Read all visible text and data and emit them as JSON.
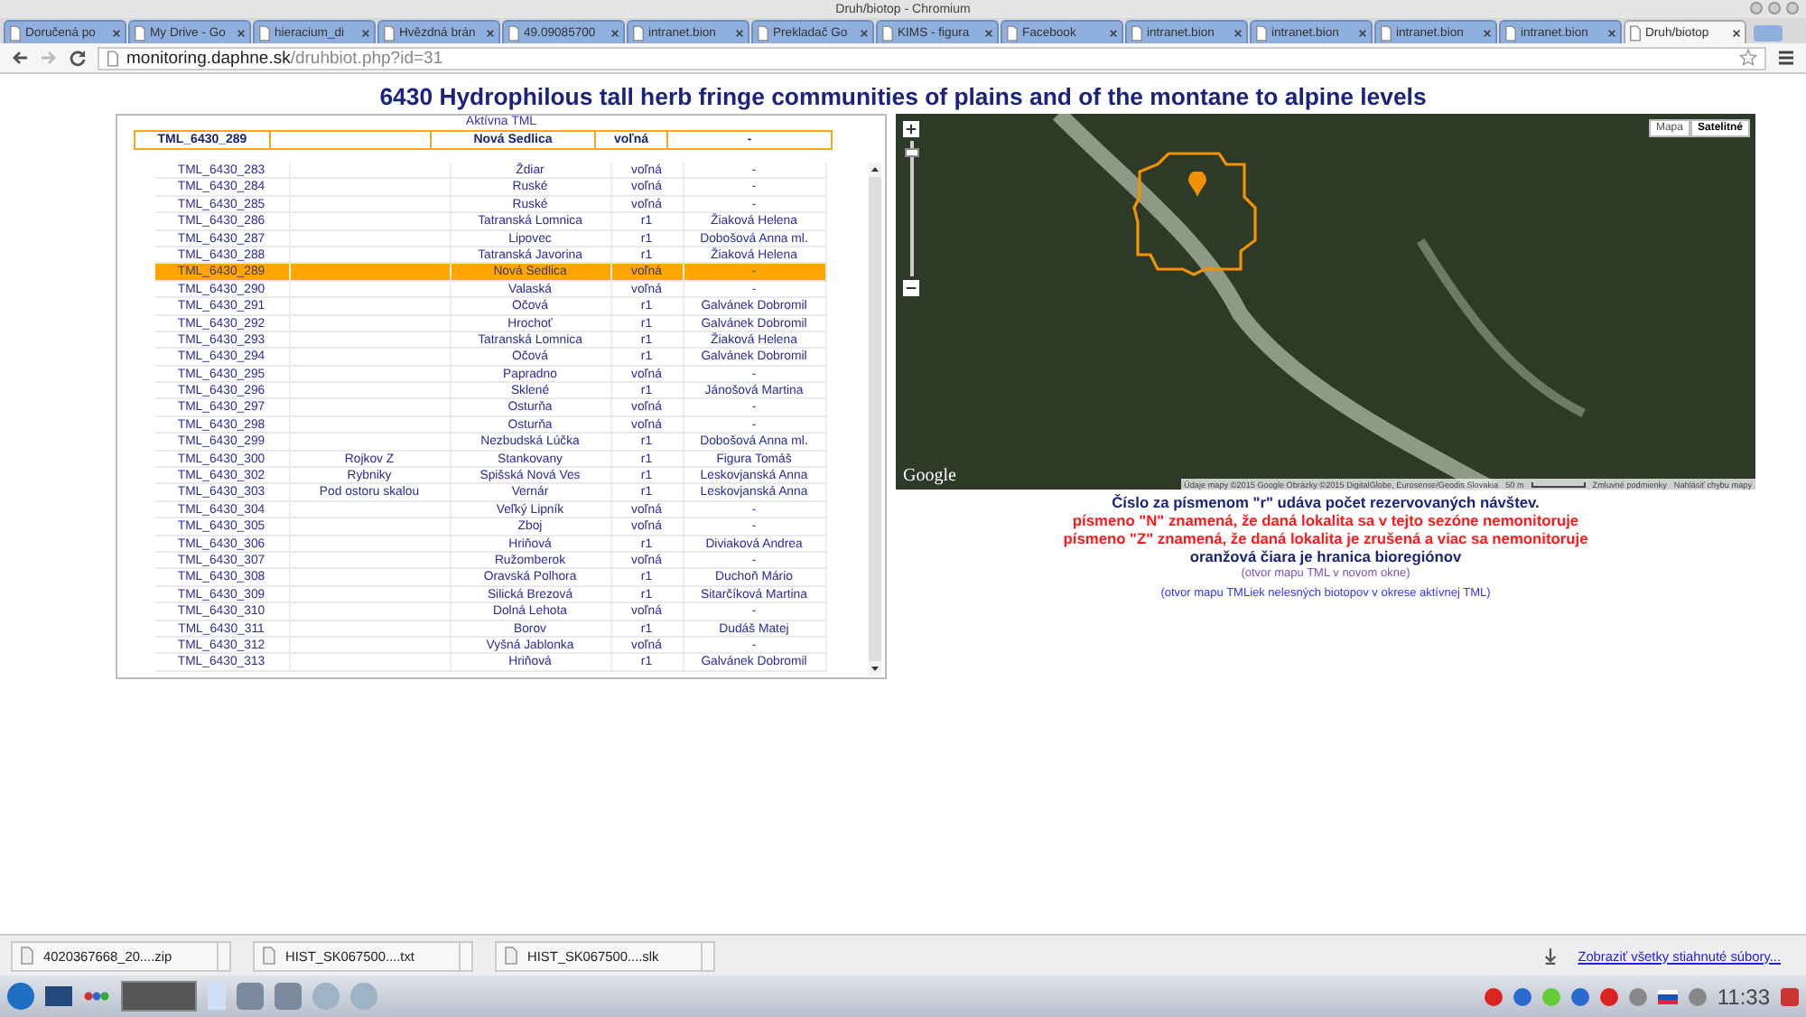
{
  "window": {
    "title": "Druh/biotop - Chromium"
  },
  "tabs": [
    {
      "label": "Doručená po",
      "selected": false
    },
    {
      "label": "My Drive - Go",
      "selected": false
    },
    {
      "label": "hieracium_di",
      "selected": false
    },
    {
      "label": "Hvězdná brán",
      "selected": false
    },
    {
      "label": "49.09085700",
      "selected": false
    },
    {
      "label": "intranet.bion",
      "selected": false
    },
    {
      "label": "Prekladač Go",
      "selected": false
    },
    {
      "label": "KIMS - figura",
      "selected": false
    },
    {
      "label": "Facebook",
      "selected": false
    },
    {
      "label": "intranet.bion",
      "selected": false
    },
    {
      "label": "intranet.bion",
      "selected": false
    },
    {
      "label": "intranet.bion",
      "selected": false
    },
    {
      "label": "intranet.bion",
      "selected": false
    },
    {
      "label": "Druh/biotop",
      "selected": true
    }
  ],
  "address": {
    "host": "monitoring.daphne.sk",
    "path": "/druhbiot.php?id=31"
  },
  "page": {
    "heading": "6430 Hydrophilous tall herb fringe communities of plains and of the montane to alpine levels",
    "active_caption": "Aktívna TML",
    "active_row": {
      "column_1": "TML_6430_289",
      "column_3": "Nová Sedlica",
      "column_4": "voľná",
      "column_5": "-"
    },
    "rows": [
      {
        "column_1": "TML_6430_283",
        "column_3": "Ždiar",
        "column_4": "voľná",
        "column_5": "-",
        "selected": false
      },
      {
        "column_1": "TML_6430_284",
        "column_3": "Ruské",
        "column_4": "voľná",
        "column_5": "-",
        "selected": false
      },
      {
        "column_1": "TML_6430_285",
        "column_3": "Ruské",
        "column_4": "voľná",
        "column_5": "-",
        "selected": false
      },
      {
        "column_1": "TML_6430_286",
        "column_3": "Tatranská Lomnica",
        "column_4": "r1",
        "column_5": "Žiaková Helena",
        "selected": false
      },
      {
        "column_1": "TML_6430_287",
        "column_3": "Lipovec",
        "column_4": "r1",
        "column_5": "Dobošová Anna ml.",
        "selected": false
      },
      {
        "column_1": "TML_6430_288",
        "column_3": "Tatranská Javorina",
        "column_4": "r1",
        "column_5": "Žiaková Helena",
        "selected": false
      },
      {
        "column_1": "TML_6430_289",
        "column_3": "Nová Sedlica",
        "column_4": "voľná",
        "column_5": "-",
        "selected": true
      },
      {
        "column_1": "TML_6430_290",
        "column_3": "Valaská",
        "column_4": "voľná",
        "column_5": "-",
        "selected": false
      },
      {
        "column_1": "TML_6430_291",
        "column_3": "Očová",
        "column_4": "r1",
        "column_5": "Galvánek Dobromil",
        "selected": false
      },
      {
        "column_1": "TML_6430_292",
        "column_3": "Hrochoť",
        "column_4": "r1",
        "column_5": "Galvánek Dobromil",
        "selected": false
      },
      {
        "column_1": "TML_6430_293",
        "column_3": "Tatranská Lomnica",
        "column_4": "r1",
        "column_5": "Žiaková Helena",
        "selected": false
      },
      {
        "column_1": "TML_6430_294",
        "column_3": "Očová",
        "column_4": "r1",
        "column_5": "Galvánek Dobromil",
        "selected": false
      },
      {
        "column_1": "TML_6430_295",
        "column_3": "Papradno",
        "column_4": "voľná",
        "column_5": "-",
        "selected": false
      },
      {
        "column_1": "TML_6430_296",
        "column_3": "Sklené",
        "column_4": "r1",
        "column_5": "Jánošová Martina",
        "selected": false
      },
      {
        "column_1": "TML_6430_297",
        "column_3": "Osturňa",
        "column_4": "voľná",
        "column_5": "-",
        "selected": false
      },
      {
        "column_1": "TML_6430_298",
        "column_3": "Osturňa",
        "column_4": "voľná",
        "column_5": "-",
        "selected": false
      },
      {
        "column_1": "TML_6430_299",
        "column_3": "Nezbudská Lúčka",
        "column_4": "r1",
        "column_5": "Dobošová Anna ml.",
        "selected": false
      },
      {
        "column_1": "TML_6430_300",
        "column_2": "Rojkov Z",
        "column_3": "Stankovany",
        "column_4": "r1",
        "column_5": "Figura Tomáš",
        "selected": false
      },
      {
        "column_1": "TML_6430_302",
        "column_2": "Rybniky",
        "column_3": "Spišská Nová Ves",
        "column_4": "r1",
        "column_5": "Leskovjanská Anna",
        "selected": false
      },
      {
        "column_1": "TML_6430_303",
        "column_2": "Pod ostoru skalou",
        "column_3": "Vernár",
        "column_4": "r1",
        "column_5": "Leskovjanská Anna",
        "selected": false
      },
      {
        "column_1": "TML_6430_304",
        "column_3": "Veľký Lipník",
        "column_4": "voľná",
        "column_5": "-",
        "selected": false
      },
      {
        "column_1": "TML_6430_305",
        "column_3": "Zboj",
        "column_4": "voľná",
        "column_5": "-",
        "selected": false
      },
      {
        "column_1": "TML_6430_306",
        "column_3": "Hriňová",
        "column_4": "r1",
        "column_5": "Diviaková Andrea",
        "selected": false
      },
      {
        "column_1": "TML_6430_307",
        "column_3": "Ružomberok",
        "column_4": "voľná",
        "column_5": "-",
        "selected": false
      },
      {
        "column_1": "TML_6430_308",
        "column_3": "Oravská Polhora",
        "column_4": "r1",
        "column_5": "Duchoň Mário",
        "selected": false
      },
      {
        "column_1": "TML_6430_309",
        "column_3": "Silická Brezová",
        "column_4": "r1",
        "column_5": "Sitarčíková Martina",
        "selected": false
      },
      {
        "column_1": "TML_6430_310",
        "column_3": "Dolná Lehota",
        "column_4": "voľná",
        "column_5": "-",
        "selected": false
      },
      {
        "column_1": "TML_6430_311",
        "column_3": "Borov",
        "column_4": "r1",
        "column_5": "Dudáš Matej",
        "selected": false
      },
      {
        "column_1": "TML_6430_312",
        "column_3": "Vyšná Jablonka",
        "column_4": "voľná",
        "column_5": "-",
        "selected": false
      },
      {
        "column_1": "TML_6430_313",
        "column_3": "Hriňová",
        "column_4": "r1",
        "column_5": "Galvánek Dobromil",
        "selected": false
      }
    ],
    "map": {
      "types": [
        {
          "label": "Mapa",
          "selected": false
        },
        {
          "label": "Satelitné",
          "selected": true
        }
      ],
      "zoom": {
        "level": 0.95
      },
      "logo": "Google",
      "attribution": "Údaje mapy ©2015 Google Obrázky ©2015 DigitalGlobe, Eurosense/Geodis Slovakia",
      "scale": "50 m",
      "terms": "Zmluvné podmienky",
      "report": "Nahlásiť chybu mapy"
    },
    "notes": [
      {
        "kind": "note",
        "text": "Číslo za písmenom \"r\" udáva počet rezervovaných návštev."
      },
      {
        "kind": "warning",
        "text": "písmeno \"N\" znamená, že daná lokalita sa v tejto sezóne nemonitoruje"
      },
      {
        "kind": "warning",
        "text": "písmeno \"Z\" znamená, že daná lokalita je zrušená a viac sa nemonitoruje"
      },
      {
        "kind": "note",
        "text": "oranžová čiara je hranica bioregiónov"
      },
      {
        "kind": "visited-link",
        "text": "(otvor mapu TML v novom okne)"
      },
      {
        "kind": "link",
        "text": "(otvor mapu TMLiek nelesných biotopov v okrese aktívnej TML)"
      }
    ]
  },
  "downloads": {
    "items": [
      "4020367668_20....zip",
      "HIST_SK067500....txt",
      "HIST_SK067500....slk"
    ],
    "show_all": "Zobraziť všetky stiahnuté súbory..."
  },
  "taskbar": {
    "clock": "11:33"
  }
}
